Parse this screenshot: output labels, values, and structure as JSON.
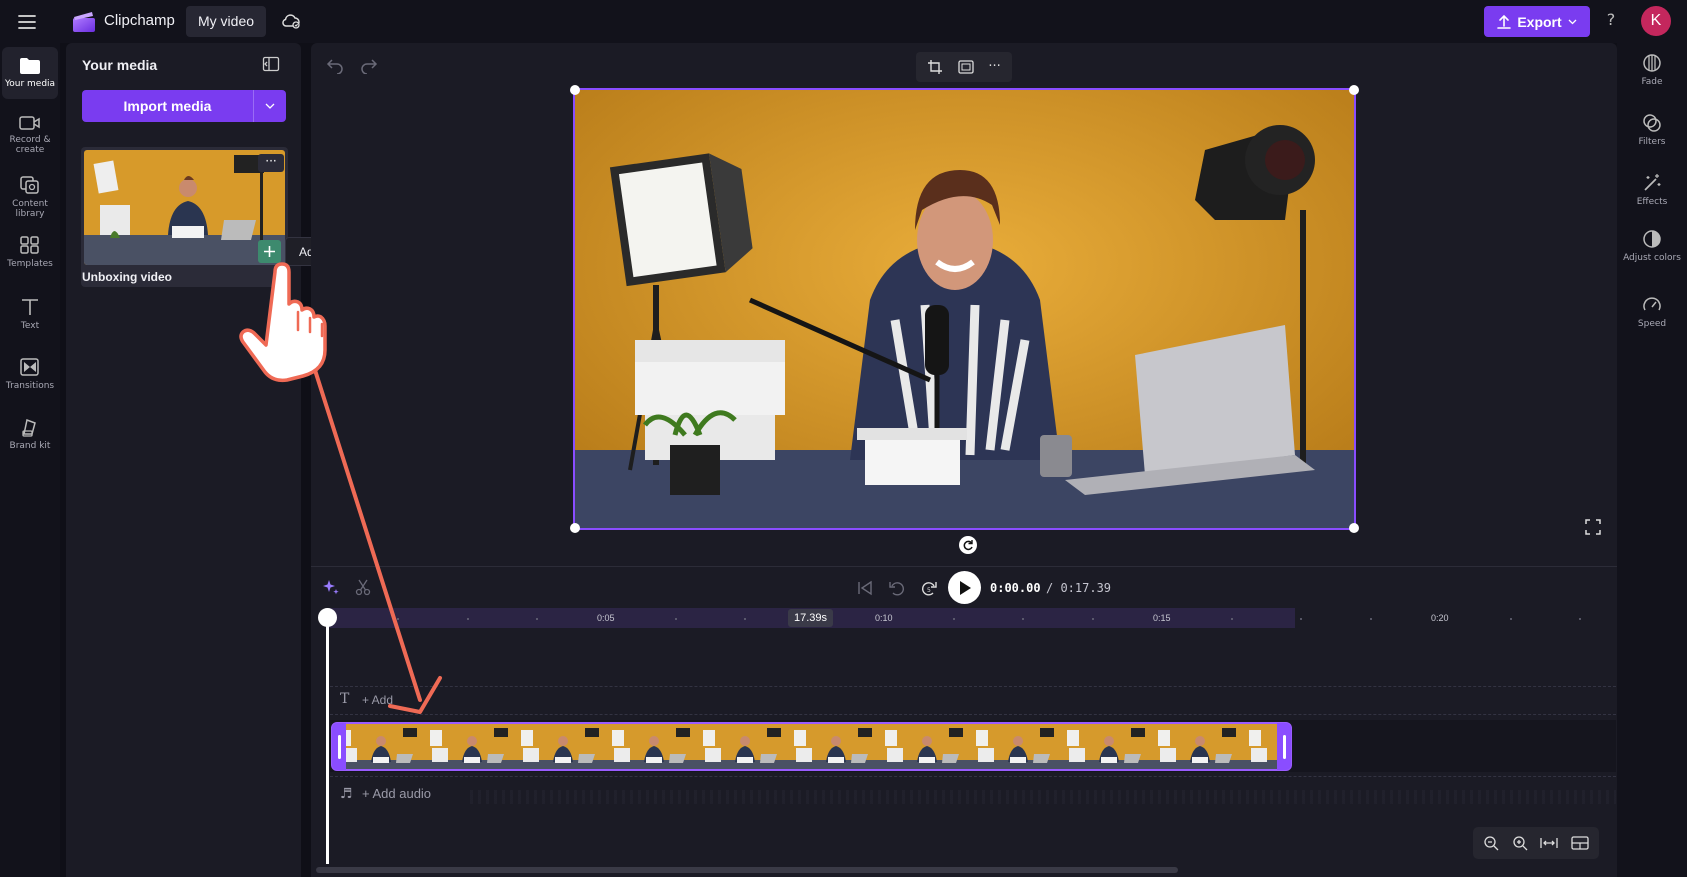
{
  "topbar": {
    "app_name": "Clipchamp",
    "project_name": "My video",
    "export_label": "Export",
    "help_label": "?",
    "avatar_initial": "K"
  },
  "left_rail": {
    "items": [
      {
        "label": "Your media",
        "icon": "folder-icon"
      },
      {
        "label": "Record & create",
        "icon": "video-camera-icon"
      },
      {
        "label": "Content library",
        "icon": "content-library-icon"
      },
      {
        "label": "Templates",
        "icon": "templates-icon"
      },
      {
        "label": "Text",
        "icon": "text-icon"
      },
      {
        "label": "Transitions",
        "icon": "transitions-icon"
      },
      {
        "label": "Brand kit",
        "icon": "brand-kit-icon"
      }
    ]
  },
  "media_panel": {
    "title": "Your media",
    "import_label": "Import media",
    "media_item": {
      "name": "Unboxing video",
      "more_label": "···"
    },
    "tooltip": "Add to timeline"
  },
  "preview": {
    "toolbar_more": "···"
  },
  "right_rail": {
    "items": [
      {
        "label": "Fade",
        "icon": "fade-icon"
      },
      {
        "label": "Filters",
        "icon": "filters-icon"
      },
      {
        "label": "Effects",
        "icon": "effects-icon"
      },
      {
        "label": "Adjust colors",
        "icon": "adjust-colors-icon"
      },
      {
        "label": "Speed",
        "icon": "speed-icon"
      }
    ]
  },
  "timeline": {
    "current_time": "0:00.00",
    "total_time": "/ 0:17.39",
    "duration_badge": "17.39s",
    "ruler_labels": [
      "0:05",
      "0:10",
      "0:15",
      "0:20"
    ],
    "text_track_label": "+ Add",
    "text_track_icon": "T",
    "audio_track_label": "+ Add audio",
    "audio_track_icon": "♬"
  },
  "colors": {
    "accent": "#7a3cf0",
    "clip_border": "#9a5cff",
    "annotation": "#ef6a55",
    "avatar": "#c4275d"
  }
}
